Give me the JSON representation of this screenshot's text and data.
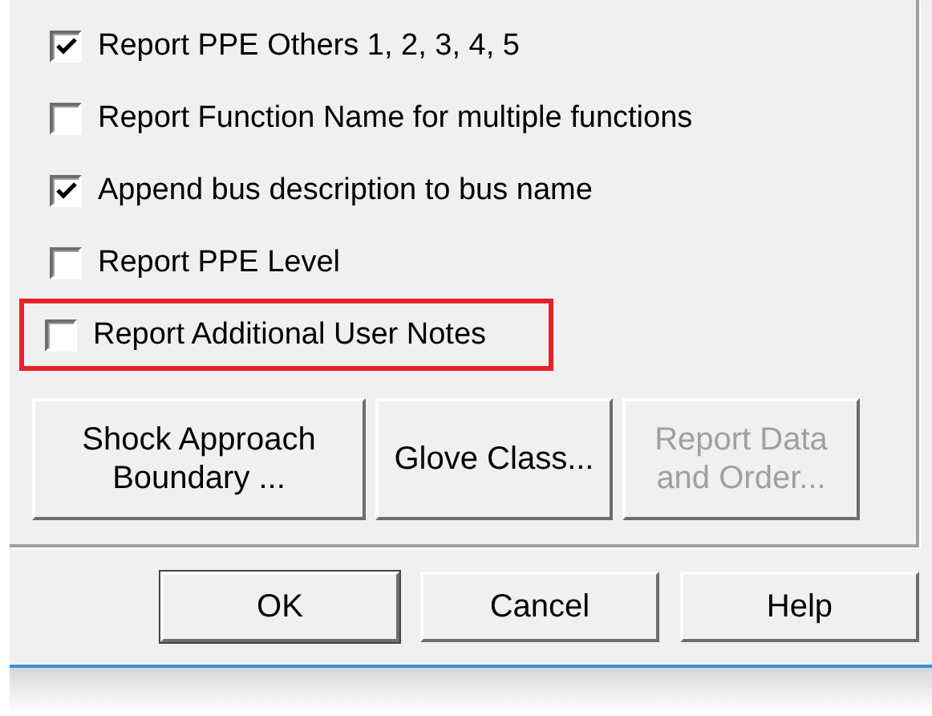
{
  "options": [
    {
      "label": "Report PPE Others 1, 2, 3, 4, 5",
      "checked": true,
      "highlighted": false
    },
    {
      "label": "Report Function Name for multiple functions",
      "checked": false,
      "highlighted": false
    },
    {
      "label": "Append bus description to bus name",
      "checked": true,
      "highlighted": false
    },
    {
      "label": "Report PPE Level",
      "checked": false,
      "highlighted": false
    },
    {
      "label": "Report Additional User Notes",
      "checked": false,
      "highlighted": true
    }
  ],
  "group_buttons": [
    {
      "label": "Shock Approach Boundary ...",
      "disabled": false
    },
    {
      "label": "Glove Class...",
      "disabled": false
    },
    {
      "label": "Report Data and Order...",
      "disabled": true
    }
  ],
  "dialog_buttons": [
    {
      "label": "OK",
      "default": true
    },
    {
      "label": "Cancel",
      "default": false
    },
    {
      "label": "Help",
      "default": false
    }
  ]
}
